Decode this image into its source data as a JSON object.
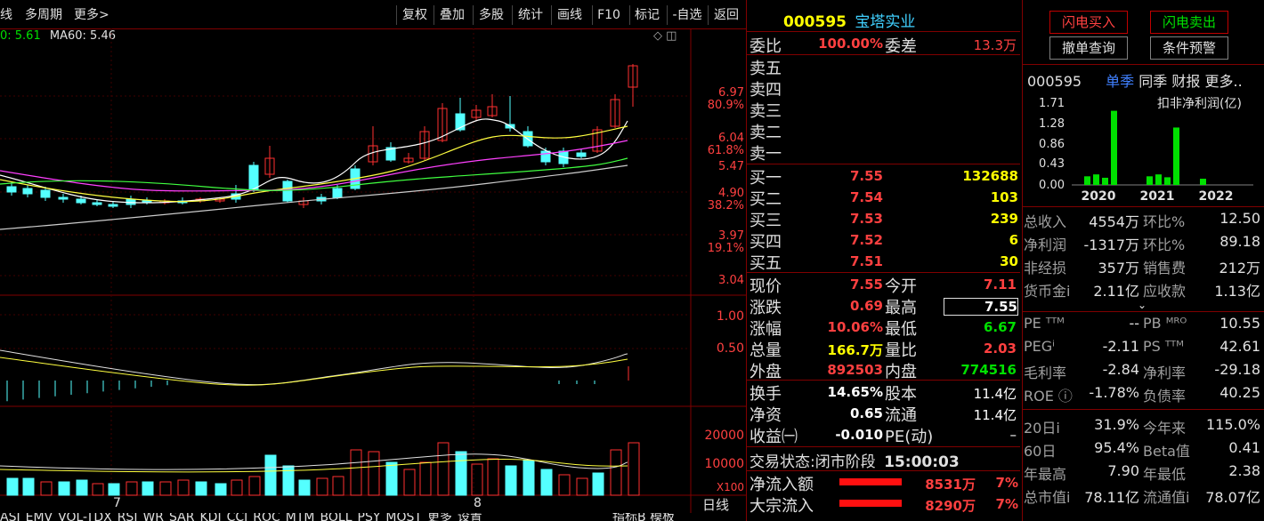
{
  "toolbar": {
    "left": [
      "线",
      "多周期",
      "更多>"
    ],
    "buttons": [
      "复权",
      "叠加",
      "多股",
      "统计",
      "画线",
      "F10",
      "标记",
      "-自选",
      "返回"
    ]
  },
  "ma_legend": {
    "ma20": "0: 5.61",
    "ma60": "MA60: 5.46"
  },
  "price_axis": [
    {
      "v": "6.97",
      "p": "80.9%"
    },
    {
      "v": "6.04",
      "p": "61.8%"
    },
    {
      "v": "5.47",
      "p": ""
    },
    {
      "v": "4.90",
      "p": "38.2%"
    },
    {
      "v": "3.97",
      "p": "19.1%"
    },
    {
      "v": "3.04",
      "p": ""
    }
  ],
  "macd_axis": [
    "1.00",
    "0.50"
  ],
  "vol_axis": [
    "20000",
    "10000",
    "X100"
  ],
  "x_labels": {
    "m7": "7",
    "m8": "8"
  },
  "bottom_tabs": [
    "ASI",
    "EMV",
    "VOL-TDX",
    "RSI",
    "WR",
    "SAR",
    "KDJ",
    "CCI",
    "ROC",
    "MTM",
    "BOLL",
    "PSY",
    "MOST",
    "更多",
    "设置"
  ],
  "bottom_right": [
    "指标B",
    "模板",
    "日线"
  ],
  "stock": {
    "code": "000595",
    "name": "宝塔实业"
  },
  "weibi": {
    "label": "委比",
    "value": "100.00%",
    "label2": "委差",
    "value2": "13.3万"
  },
  "asks": [
    "卖五",
    "卖四",
    "卖三",
    "卖二",
    "卖一"
  ],
  "bids": [
    {
      "label": "买一",
      "price": "7.55",
      "vol": "132688"
    },
    {
      "label": "买二",
      "price": "7.54",
      "vol": "103"
    },
    {
      "label": "买三",
      "price": "7.53",
      "vol": "239"
    },
    {
      "label": "买四",
      "price": "7.52",
      "vol": "6"
    },
    {
      "label": "买五",
      "price": "7.51",
      "vol": "30"
    }
  ],
  "quote": [
    {
      "l": "现价",
      "v": "7.55",
      "l2": "今开",
      "v2": "7.11"
    },
    {
      "l": "涨跌",
      "v": "0.69",
      "l2": "最高",
      "v2": "7.55"
    },
    {
      "l": "涨幅",
      "v": "10.06%",
      "l2": "最低",
      "v2": "6.67"
    },
    {
      "l": "总量",
      "v": "166.7万",
      "l2": "量比",
      "v2": "2.03"
    },
    {
      "l": "外盘",
      "v": "892503",
      "l2": "内盘",
      "v2": "774516"
    }
  ],
  "stats": [
    {
      "l": "换手",
      "v": "14.65%",
      "l2": "股本",
      "v2": "11.4亿"
    },
    {
      "l": "净资",
      "v": "0.65",
      "l2": "流通",
      "v2": "11.4亿"
    },
    {
      "l": "收益㈠",
      "v": "-0.010",
      "l2": "PE(动)",
      "v2": "–"
    }
  ],
  "trade_status": {
    "label": "交易状态:",
    "value": "闭市阶段",
    "time": "15:00:03"
  },
  "flows": [
    {
      "l": "净流入额",
      "v": "8531万",
      "p": "7%"
    },
    {
      "l": "大宗流入",
      "v": "8290万",
      "p": "7%"
    }
  ],
  "right_buttons": {
    "buy": "闪电买入",
    "sell": "闪电卖出",
    "cancel": "撤单查询",
    "cond": "条件预警"
  },
  "fin_header": {
    "code": "000595",
    "tabs": [
      "单季",
      "同季",
      "财报",
      "更多.."
    ]
  },
  "mini_chart": {
    "title": "扣非净利润(亿)"
  },
  "chart_data": {
    "type": "bar",
    "title": "扣非净利润(亿)",
    "yticks": [
      "1.71",
      "1.28",
      "0.86",
      "0.43",
      "0.00"
    ],
    "ylim": [
      0,
      1.71
    ],
    "xticks": [
      "2020",
      "2021",
      "2022"
    ],
    "values": [
      0.18,
      0.22,
      0.15,
      1.55,
      0.18,
      0.22,
      0.16,
      1.2,
      0.13
    ],
    "color": "#00e000"
  },
  "fin_rows": [
    {
      "l": "总收入",
      "v": "4554万",
      "l2": "环比%",
      "v2": "12.50"
    },
    {
      "l": "净利润",
      "v": "-1317万",
      "l2": "环比%",
      "v2": "89.18"
    },
    {
      "l": "非经损",
      "v": "357万",
      "l2": "销售费",
      "v2": "212万"
    },
    {
      "l": "货币金i",
      "v": "2.11亿",
      "l2": "应收款",
      "v2": "1.13亿"
    }
  ],
  "val_rows": [
    {
      "l": "PE ᵀᵀᴹ",
      "v": "--",
      "l2": "PB ᴹᴿᴼ",
      "v2": "10.55"
    },
    {
      "l": "PEGⁱ",
      "v": "-2.11",
      "l2": "PS ᵀᵀᴹ",
      "v2": "42.61"
    },
    {
      "l": "毛利率",
      "v": "-2.84",
      "l2": "净利率",
      "v2": "-29.18"
    },
    {
      "l": "ROE ⓘ",
      "v": "-1.78%",
      "l2": "负债率",
      "v2": "40.25"
    }
  ],
  "perf_rows": [
    {
      "l": "20日i",
      "v": "31.9%",
      "l2": "今年来",
      "v2": "115.0%"
    },
    {
      "l": "60日",
      "v": "95.4%",
      "l2": "Beta值",
      "v2": "0.41"
    },
    {
      "l": "年最高",
      "v": "7.90",
      "l2": "年最低",
      "v2": "2.38"
    },
    {
      "l": "总市值i",
      "v": "78.11亿",
      "l2": "流通值i",
      "v2": "78.07亿"
    }
  ]
}
